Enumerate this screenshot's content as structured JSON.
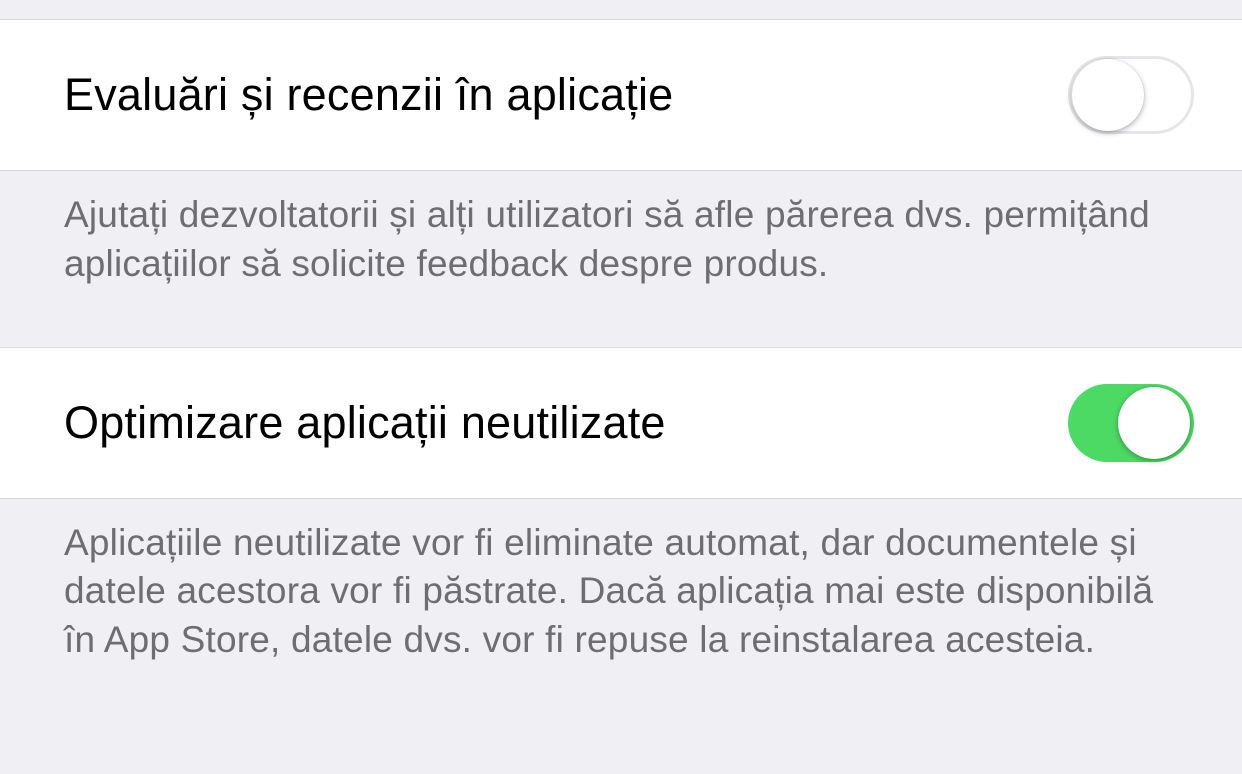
{
  "settings": [
    {
      "label": "Evaluări și recenzii în aplicație",
      "enabled": false,
      "description": "Ajutați dezvoltatorii și alți utilizatori să afle părerea dvs. permițând aplicațiilor să solicite feedback despre produs."
    },
    {
      "label": "Optimizare aplicații neutilizate",
      "enabled": true,
      "description": "Aplicațiile neutilizate vor fi eliminate automat, dar documentele și datele acestora vor fi păstrate. Dacă aplicația mai este disponibilă în App Store, datele dvs. vor fi repuse la reinstalarea acesteia."
    }
  ]
}
